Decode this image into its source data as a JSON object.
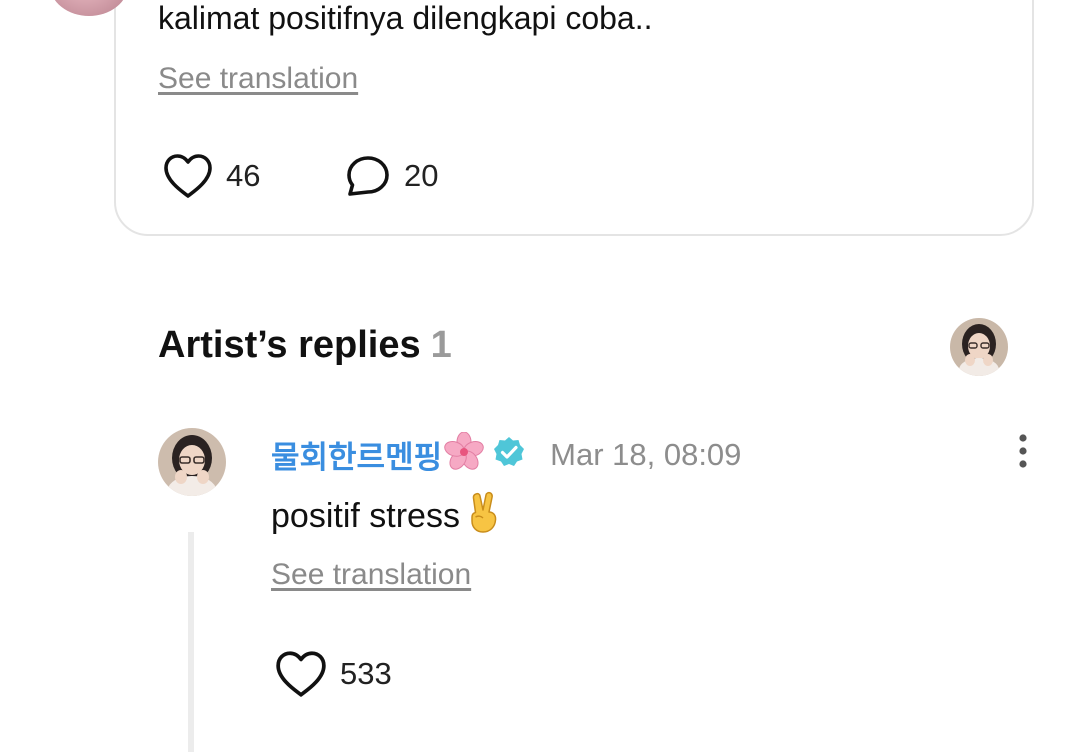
{
  "post": {
    "text": "kalimat positifnya dilengkapi coba..",
    "see_translation": "See translation",
    "likes": "46",
    "comments": "20"
  },
  "artist_replies": {
    "title": "Artist’s replies",
    "count": "1"
  },
  "reply": {
    "author": "물회한르멘핑",
    "author_emoji": "cherry-blossom-icon",
    "verified_icon": "verified-badge-icon",
    "timestamp": "Mar 18, 08:09",
    "text": "positif stress",
    "text_emoji": "victory-hand-icon",
    "see_translation": "See translation",
    "likes": "533"
  },
  "colors": {
    "author_name": "#3a8ee0",
    "verified": "#4fc6d8",
    "muted_text": "#8a8a8a",
    "card_border": "#e4e4e4",
    "thread_line": "#ececec"
  }
}
